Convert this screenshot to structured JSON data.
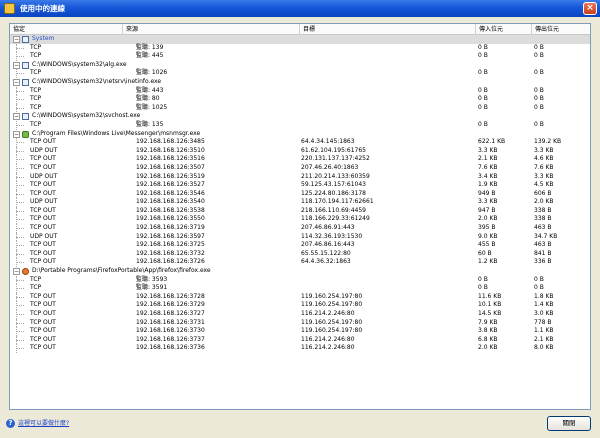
{
  "window": {
    "title": "使用中的連線",
    "close_label": "×"
  },
  "columns": {
    "protocol": "協定",
    "source": "來源",
    "destination": "目標",
    "sent": "傳入位元",
    "received": "傳出位元"
  },
  "groups": [
    {
      "name": "System",
      "icon": "generic",
      "selected": true,
      "rows": [
        {
          "proto": "TCP",
          "src": "監聽: 139",
          "dst": "",
          "sent": "0 B",
          "recv": "0 B"
        },
        {
          "proto": "TCP",
          "src": "監聽: 445",
          "dst": "",
          "sent": "0 B",
          "recv": "0 B"
        }
      ]
    },
    {
      "name": "C:\\WINDOWS\\system32\\alg.exe",
      "icon": "generic",
      "rows": [
        {
          "proto": "TCP",
          "src": "監聽: 1026",
          "dst": "",
          "sent": "0 B",
          "recv": "0 B"
        }
      ]
    },
    {
      "name": "C:\\WINDOWS\\system32\\netsrv\\inetinfo.exe",
      "icon": "generic",
      "rows": [
        {
          "proto": "TCP",
          "src": "監聽: 443",
          "dst": "",
          "sent": "0 B",
          "recv": "0 B"
        },
        {
          "proto": "TCP",
          "src": "監聽: 80",
          "dst": "",
          "sent": "0 B",
          "recv": "0 B"
        },
        {
          "proto": "TCP",
          "src": "監聽: 1025",
          "dst": "",
          "sent": "0 B",
          "recv": "0 B"
        }
      ]
    },
    {
      "name": "C:\\WINDOWS\\system32\\svchost.exe",
      "icon": "generic",
      "rows": [
        {
          "proto": "TCP",
          "src": "監聽: 135",
          "dst": "",
          "sent": "0 B",
          "recv": "0 B"
        }
      ]
    },
    {
      "name": "C:\\Program Files\\Windows Live\\Messenger\\msnmsgr.exe",
      "icon": "msn",
      "rows": [
        {
          "proto": "TCP OUT",
          "src": "192.168.168.126:3485",
          "dst": "64.4.34.145:1863",
          "sent": "622.1 KB",
          "recv": "139.2 KB"
        },
        {
          "proto": "UDP OUT",
          "src": "192.168.168.126:3510",
          "dst": "61.62.104.195:61765",
          "sent": "3.3 KB",
          "recv": "3.3 KB"
        },
        {
          "proto": "TCP OUT",
          "src": "192.168.168.126:3516",
          "dst": "220.131.137.137:4252",
          "sent": "2.1 KB",
          "recv": "4.6 KB"
        },
        {
          "proto": "TCP OUT",
          "src": "192.168.168.126:3507",
          "dst": "207.46.26.40:1863",
          "sent": "7.6 KB",
          "recv": "7.6 KB"
        },
        {
          "proto": "UDP OUT",
          "src": "192.168.168.126:3519",
          "dst": "211.20.214.133:60359",
          "sent": "3.4 KB",
          "recv": "3.3 KB"
        },
        {
          "proto": "TCP OUT",
          "src": "192.168.168.126:3527",
          "dst": "59.125.43.157:61043",
          "sent": "1.9 KB",
          "recv": "4.5 KB"
        },
        {
          "proto": "TCP OUT",
          "src": "192.168.168.126:3546",
          "dst": "125.224.80.186:3178",
          "sent": "949 B",
          "recv": "606 B"
        },
        {
          "proto": "UDP OUT",
          "src": "192.168.168.126:3540",
          "dst": "118.170.194.117:62661",
          "sent": "3.3 KB",
          "recv": "2.0 KB"
        },
        {
          "proto": "TCP OUT",
          "src": "192.168.168.126:3538",
          "dst": "218.166.110.69:4459",
          "sent": "947 B",
          "recv": "338 B"
        },
        {
          "proto": "TCP OUT",
          "src": "192.168.168.126:3550",
          "dst": "118.166.229.33:61249",
          "sent": "2.0 KB",
          "recv": "338 B"
        },
        {
          "proto": "TCP OUT",
          "src": "192.168.168.126:3719",
          "dst": "207.46.86.91:443",
          "sent": "395 B",
          "recv": "463 B"
        },
        {
          "proto": "UDP OUT",
          "src": "192.168.168.126:3597",
          "dst": "114.32.36.193:1530",
          "sent": "9.0 KB",
          "recv": "34.7 KB"
        },
        {
          "proto": "TCP OUT",
          "src": "192.168.168.126:3725",
          "dst": "207.46.86.16:443",
          "sent": "455 B",
          "recv": "463 B"
        },
        {
          "proto": "TCP OUT",
          "src": "192.168.168.126:3732",
          "dst": "65.55.15.122:80",
          "sent": "60 B",
          "recv": "841 B"
        },
        {
          "proto": "TCP OUT",
          "src": "192.168.168.126:3726",
          "dst": "64.4.36.32:1863",
          "sent": "1.2 KB",
          "recv": "336 B"
        }
      ]
    },
    {
      "name": "D:\\Portable Programs\\FirefoxPortable\\App\\firefox\\firefox.exe",
      "icon": "firefox",
      "rows": [
        {
          "proto": "TCP",
          "src": "監聽: 3593",
          "dst": "",
          "sent": "0 B",
          "recv": "0 B"
        },
        {
          "proto": "TCP",
          "src": "監聽: 3591",
          "dst": "",
          "sent": "0 B",
          "recv": "0 B"
        },
        {
          "proto": "TCP OUT",
          "src": "192.168.168.126:3728",
          "dst": "119.160.254.197:80",
          "sent": "11.6 KB",
          "recv": "1.8 KB"
        },
        {
          "proto": "TCP OUT",
          "src": "192.168.168.126:3729",
          "dst": "119.160.254.197:80",
          "sent": "10.1 KB",
          "recv": "1.4 KB"
        },
        {
          "proto": "TCP OUT",
          "src": "192.168.168.126:3727",
          "dst": "116.214.2.246:80",
          "sent": "14.5 KB",
          "recv": "3.0 KB"
        },
        {
          "proto": "TCP OUT",
          "src": "192.168.168.126:3731",
          "dst": "119.160.254.197:80",
          "sent": "7.9 KB",
          "recv": "778 B"
        },
        {
          "proto": "TCP OUT",
          "src": "192.168.168.126:3730",
          "dst": "119.160.254.197:80",
          "sent": "3.8 KB",
          "recv": "1.1 KB"
        },
        {
          "proto": "TCP OUT",
          "src": "192.168.168.126:3737",
          "dst": "116.214.2.246:80",
          "sent": "6.8 KB",
          "recv": "2.1 KB"
        },
        {
          "proto": "TCP OUT",
          "src": "192.168.168.126:3736",
          "dst": "116.214.2.246:80",
          "sent": "2.0 KB",
          "recv": "8.0 KB"
        }
      ]
    }
  ],
  "footer": {
    "help_link": "這裡可以要做什麼?",
    "ok_button": "關閉"
  }
}
